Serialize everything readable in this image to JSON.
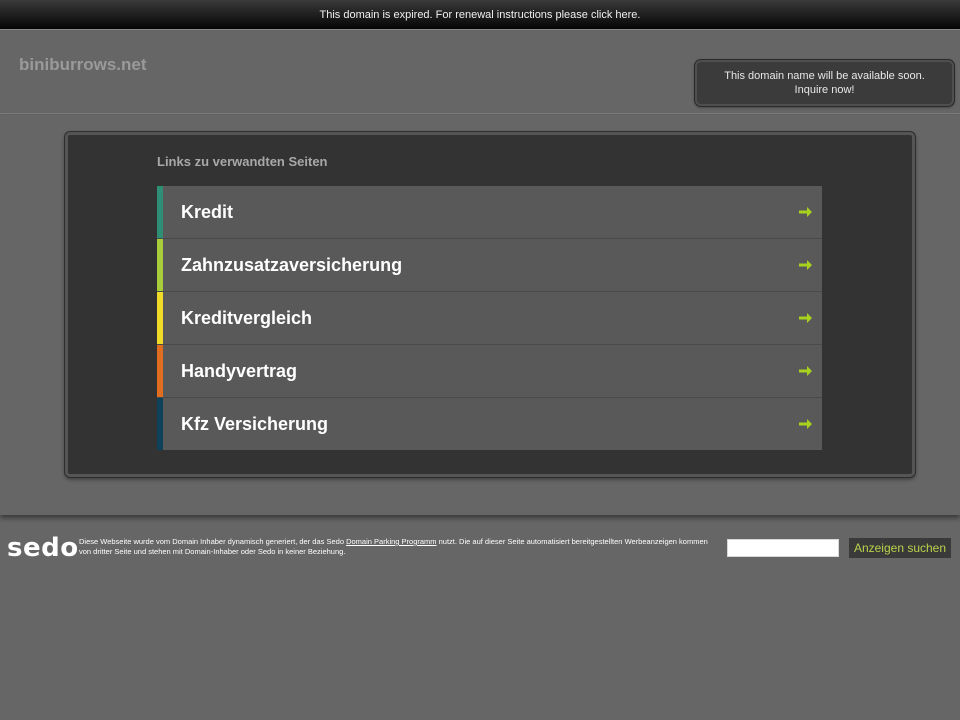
{
  "topbar": {
    "notice": "This domain is expired. For renewal instructions please click here."
  },
  "header": {
    "domain": "biniburrows.net",
    "inquire_line1": "This domain name will be available soon.",
    "inquire_line2": "Inquire now!"
  },
  "panel": {
    "heading": "Links zu verwandten Seiten",
    "links": [
      {
        "label": "Kredit",
        "color": "#2f8f76"
      },
      {
        "label": "Zahnzusatzaversicherung",
        "color": "#a8cc3c"
      },
      {
        "label": "Kreditvergleich",
        "color": "#f0dc28"
      },
      {
        "label": "Handyvertrag",
        "color": "#e06e1e"
      },
      {
        "label": "Kfz Versicherung",
        "color": "#0f4258"
      }
    ],
    "arrow_icon": "arrow-right-icon",
    "arrow_color": "#a8d21e"
  },
  "footer": {
    "logo": "sedo",
    "text_before_link": "Diese Webseite wurde vom Domain Inhaber dynamisch generiert, der das Sedo ",
    "link_text": "Domain Parking Programm",
    "text_after_link": " nutzt. Die auf dieser Seite automatisiert bereitgestellten Werbeanzeigen kommen von dritter Seite und stehen mit Domain-Inhaber oder Sedo in keiner Beziehung.",
    "search_value": "",
    "search_button": "Anzeigen suchen"
  }
}
